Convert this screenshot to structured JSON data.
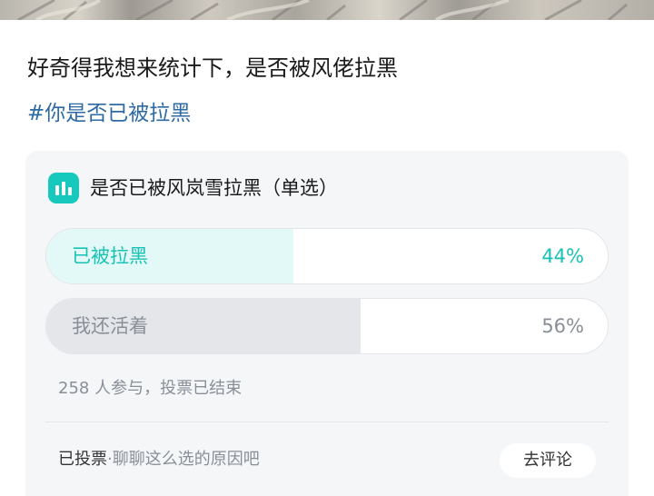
{
  "post": {
    "title": "好奇得我想来统计下，是否被风佬拉黑",
    "topic": "#你是否已被拉黑"
  },
  "poll": {
    "icon": "bar-chart-icon",
    "title": "是否已被风岚雪拉黑（单选）",
    "options": [
      {
        "label": "已被拉黑",
        "percent": "44%",
        "fraction": 0.44,
        "selected": true
      },
      {
        "label": "我还活着",
        "percent": "56%",
        "fraction": 0.56,
        "selected": false
      }
    ],
    "meta": "258 人参与，投票已结束",
    "voted_label": "已投票",
    "separator": "·",
    "comment_prompt": "聊聊这么选的原因吧",
    "comment_button": "去评论"
  },
  "colors": {
    "accent": "#17c9bd",
    "topic": "#2e6aa3",
    "selected_fill": "#e3f9f7",
    "unselected_fill": "#e4e6ea"
  }
}
